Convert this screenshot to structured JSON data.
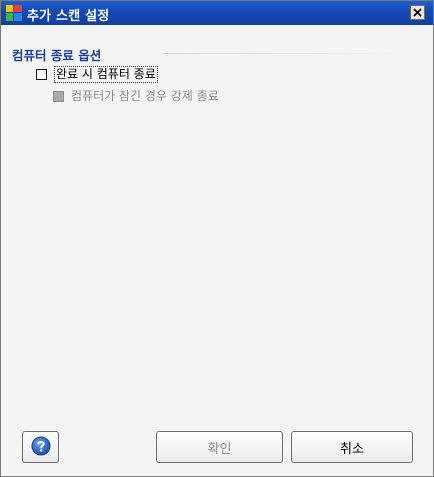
{
  "window": {
    "title": "추가 스캔 설정",
    "close_glyph": "✕",
    "colors": {
      "titlebar": "#1548b6",
      "section_title": "#1a3f9c"
    }
  },
  "section": {
    "title": "컴퓨터 종료 옵션"
  },
  "options": [
    {
      "label": "완료 시 컴퓨터 종료",
      "checked": false,
      "enabled": true,
      "focused": true
    },
    {
      "label": "컴퓨터가 잠긴 경우 강제 종료",
      "checked": false,
      "enabled": false
    }
  ],
  "footer": {
    "help_icon": "question-mark-icon",
    "ok_label": "확인",
    "cancel_label": "취소"
  }
}
